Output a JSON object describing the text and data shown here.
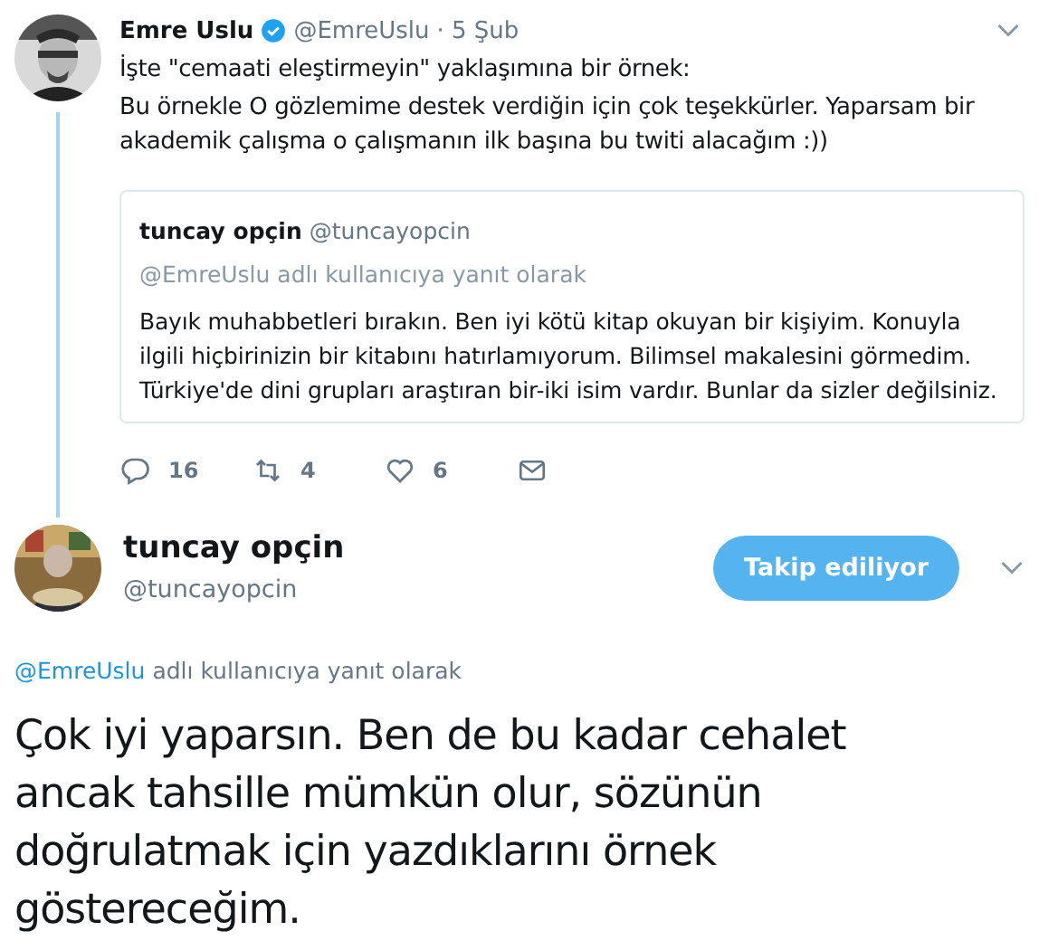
{
  "tweet": {
    "author": {
      "name": "Emre Uslu",
      "verified": true,
      "handle": "@EmreUslu",
      "date": "· 5 Şub"
    },
    "text": [
      "İşte \"cemaati eleştirmeyin\" yaklaşımına bir örnek:",
      "Bu örnekle O gözlemime destek verdiğin için çok teşekkürler. Yaparsam bir akademik çalışma o çalışmanın ilk başına bu twiti alacağım :))"
    ],
    "quote": {
      "name": "tuncay opçin",
      "handle": "@tuncayopcin",
      "reply_to": "@EmreUslu adlı kullanıcıya yanıt olarak",
      "text": "Bayık muhabbetleri bırakın. Ben iyi kötü kitap okuyan bir kişiyim. Konuyla ilgili hiçbirinizin bir kitabını hatırlamıyorum. Bilimsel makalesini görmedim. Türkiye'de dini grupları araştıran bir-iki isim vardır. Bunlar da sizler değilsiniz."
    },
    "actions": [
      {
        "kind": "reply",
        "count": "16"
      },
      {
        "kind": "retweet",
        "count": "4"
      },
      {
        "kind": "like",
        "count": "6"
      },
      {
        "kind": "message"
      }
    ]
  },
  "reply": {
    "author": {
      "name": "tuncay opçin",
      "handle": "@tuncayopcin"
    },
    "follow_button": "Takip ediliyor",
    "reply_to": {
      "mention": "@EmreUslu",
      "rest": "adlı kullanıcıya yanıt olarak"
    },
    "text": "Çok iyi yaparsın. Ben de bu kadar cehalet ancak tahsille mümkün olur, sözünün doğrulatmak için yazdıklarını örnek göstereceğim."
  }
}
